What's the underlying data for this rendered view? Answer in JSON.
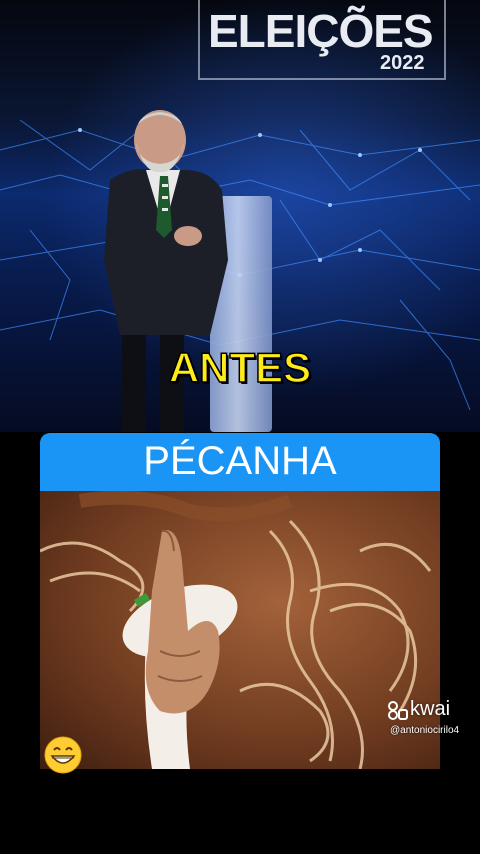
{
  "top_video": {
    "logo_title": "ELEIÇÕES",
    "logo_year": "2022",
    "caption": "ANTES"
  },
  "bottom_video": {
    "caption": "PÉCANHA"
  },
  "watermark": {
    "brand": "kwai",
    "handle": "@antoniocirilo4"
  },
  "emoji": {
    "icon": "grinning-face-emoji"
  },
  "colors": {
    "caption_yellow": "#ffeb1a",
    "pill_blue": "#1a95f5",
    "background": "#000000"
  }
}
